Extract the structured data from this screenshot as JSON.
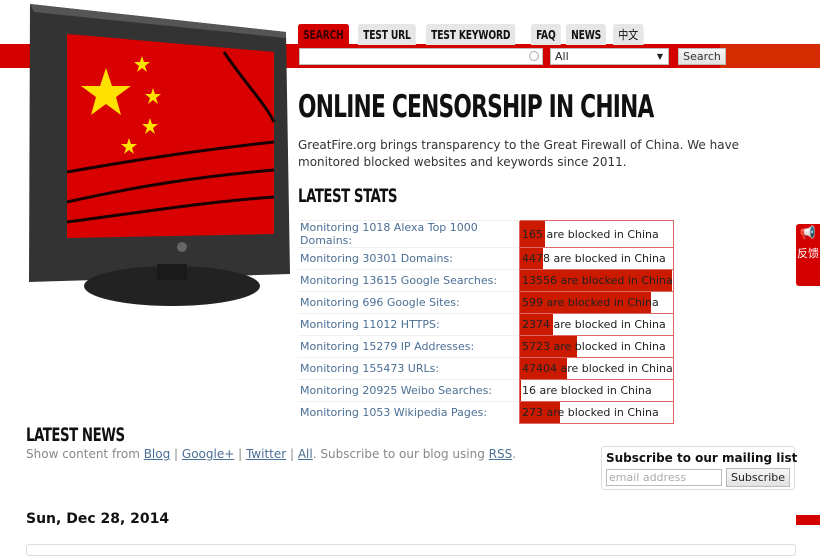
{
  "nav": {
    "tabs": [
      {
        "label": "SEARCH",
        "active": true
      },
      {
        "label": "TEST URL",
        "active": false
      },
      {
        "label": "TEST KEYWORD",
        "active": false
      },
      {
        "label": "FAQ",
        "active": false
      },
      {
        "label": "NEWS",
        "active": false
      },
      {
        "label": "中文",
        "active": false
      }
    ]
  },
  "search": {
    "query": "",
    "category_selected": "All",
    "button_label": "Search"
  },
  "hero": {
    "title": "ONLINE CENSORSHIP IN CHINA",
    "intro": "GreatFire.org brings transparency to the Great Firewall of China. We have monitored blocked websites and keywords since 2011."
  },
  "stats": {
    "heading": "LATEST STATS",
    "suffix": "are blocked in China",
    "rows": [
      {
        "label": "Monitoring 1018 Alexa Top 1000 Domains:",
        "monitored": 1018,
        "blocked": 165
      },
      {
        "label": "Monitoring 30301 Domains:",
        "monitored": 30301,
        "blocked": 4478
      },
      {
        "label": "Monitoring 13615 Google Searches:",
        "monitored": 13615,
        "blocked": 13556
      },
      {
        "label": "Monitoring 696 Google Sites:",
        "monitored": 696,
        "blocked": 599
      },
      {
        "label": "Monitoring 11012 HTTPS:",
        "monitored": 11012,
        "blocked": 2374
      },
      {
        "label": "Monitoring 15279 IP Addresses:",
        "monitored": 15279,
        "blocked": 5723
      },
      {
        "label": "Monitoring 155473 URLs:",
        "monitored": 155473,
        "blocked": 47404
      },
      {
        "label": "Monitoring 20925 Weibo Searches:",
        "monitored": 20925,
        "blocked": 16
      },
      {
        "label": "Monitoring 1053 Wikipedia Pages:",
        "monitored": 1053,
        "blocked": 273
      }
    ]
  },
  "news": {
    "heading": "LATEST NEWS",
    "prefix": "Show content from ",
    "links": [
      "Blog",
      "Google+",
      "Twitter",
      "All"
    ],
    "separator": " | ",
    "rss_text": ". Subscribe to our blog using ",
    "rss_link": "RSS",
    "rss_end": "."
  },
  "subscribe": {
    "title": "Subscribe to our mailing list",
    "placeholder": "email address",
    "button_label": "Subscribe"
  },
  "feed": {
    "date": "Sun, Dec 28, 2014"
  },
  "feedback": {
    "icon": "megaphone-icon",
    "label": "反馈"
  },
  "colors": {
    "brand_red": "#d40000",
    "bar_fill": "#cc1a00",
    "link": "#4b6f95"
  }
}
